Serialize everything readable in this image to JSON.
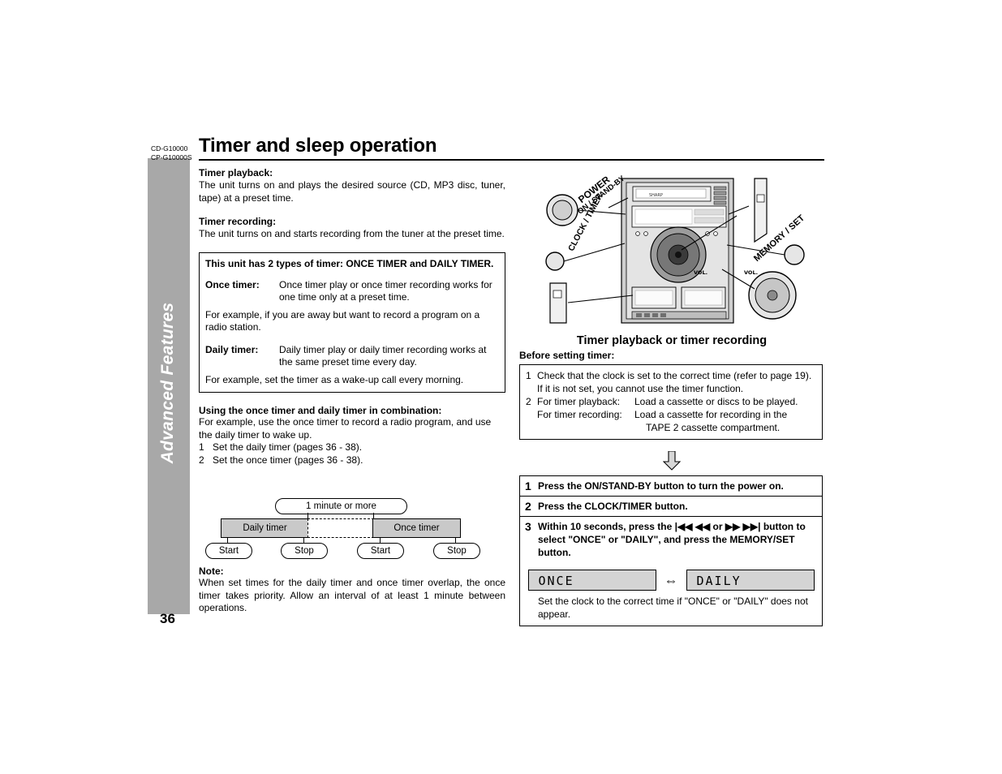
{
  "meta": {
    "model_codes": "CD-G10000\nCP-G10000S",
    "page_number": "36",
    "sidebar_label": "Advanced Features",
    "title": "Timer and sleep operation"
  },
  "left": {
    "timer_playback_head": "Timer playback:",
    "timer_playback_body": "The unit turns on and plays the desired source (CD, MP3 disc, tuner, tape) at a preset time.",
    "timer_recording_head": "Timer recording:",
    "timer_recording_body": "The unit turns on and starts recording from the tuner at the preset time.",
    "types_box": {
      "title": "This unit has 2 types of timer: ONCE TIMER and DAILY TIMER.",
      "once_term": "Once timer:",
      "once_def": "Once timer play or once timer recording works for one time only at a preset time.",
      "once_example": "For example, if you are away but want to record a program on a radio station.",
      "daily_term": "Daily timer:",
      "daily_def": "Daily timer play or daily timer recording works at the same preset time every day.",
      "daily_example": "For example, set the timer as a wake-up call every morning."
    },
    "combination_head": "Using the once timer and daily timer in combination:",
    "combination_body": "For example, use the once timer to record a radio program, and use the daily timer to wake up.",
    "combination_steps": [
      {
        "num": "1",
        "text": "Set the daily timer (pages 36 - 38)."
      },
      {
        "num": "2",
        "text": "Set the once timer (pages 36 - 38)."
      }
    ],
    "diagram": {
      "gap_label": "1 minute or more",
      "daily_bar": "Daily timer",
      "once_bar": "Once timer",
      "start_1": "Start",
      "stop_1": "Stop",
      "start_2": "Start",
      "stop_2": "Stop"
    },
    "note_head": "Note:",
    "note_body": "When set times for the daily timer and once timer overlap, the once timer takes priority. Allow an interval of at least 1 minute between operations."
  },
  "right": {
    "figure_labels": {
      "power": "POWER",
      "on_standby": "ON / STAND-BY",
      "clock_timer": "CLOCK / TIMER",
      "memory_set": "MEMORY / SET",
      "vol_left": "VOL.",
      "vol_right": "VOL.",
      "brand": "SHARP"
    },
    "figure_caption": "Timer playback or timer recording",
    "before_head": "Before setting timer:",
    "before_box": {
      "item1_num": "1",
      "item1_line1": "Check that the clock is set to the correct time (refer to page 19).",
      "item1_line2": "If it is not set, you cannot use the timer function.",
      "item2_num": "2",
      "item2_label": "For timer playback:",
      "item2_text": "Load a cassette or discs to be played.",
      "item3_label": "For timer recording:",
      "item3_line1": "Load a cassette for recording in the",
      "item3_line2": "TAPE 2 cassette compartment."
    },
    "steps": [
      {
        "num": "1",
        "text": "Press the ON/STAND-BY button to turn the power on."
      },
      {
        "num": "2",
        "text": "Press the CLOCK/TIMER button."
      },
      {
        "num": "3",
        "text": "Within 10 seconds, press the |◀◀ ◀◀ or ▶▶ ▶▶| button to select \"ONCE\" or \"DAILY\", and press the MEMORY/SET button."
      }
    ],
    "lcd_left": "ONCE",
    "lcd_right": "DAILY",
    "lcd_arrows": "⇔",
    "steps_footer": "Set the clock to the correct time if \"ONCE\" or \"DAILY\" does not appear."
  }
}
